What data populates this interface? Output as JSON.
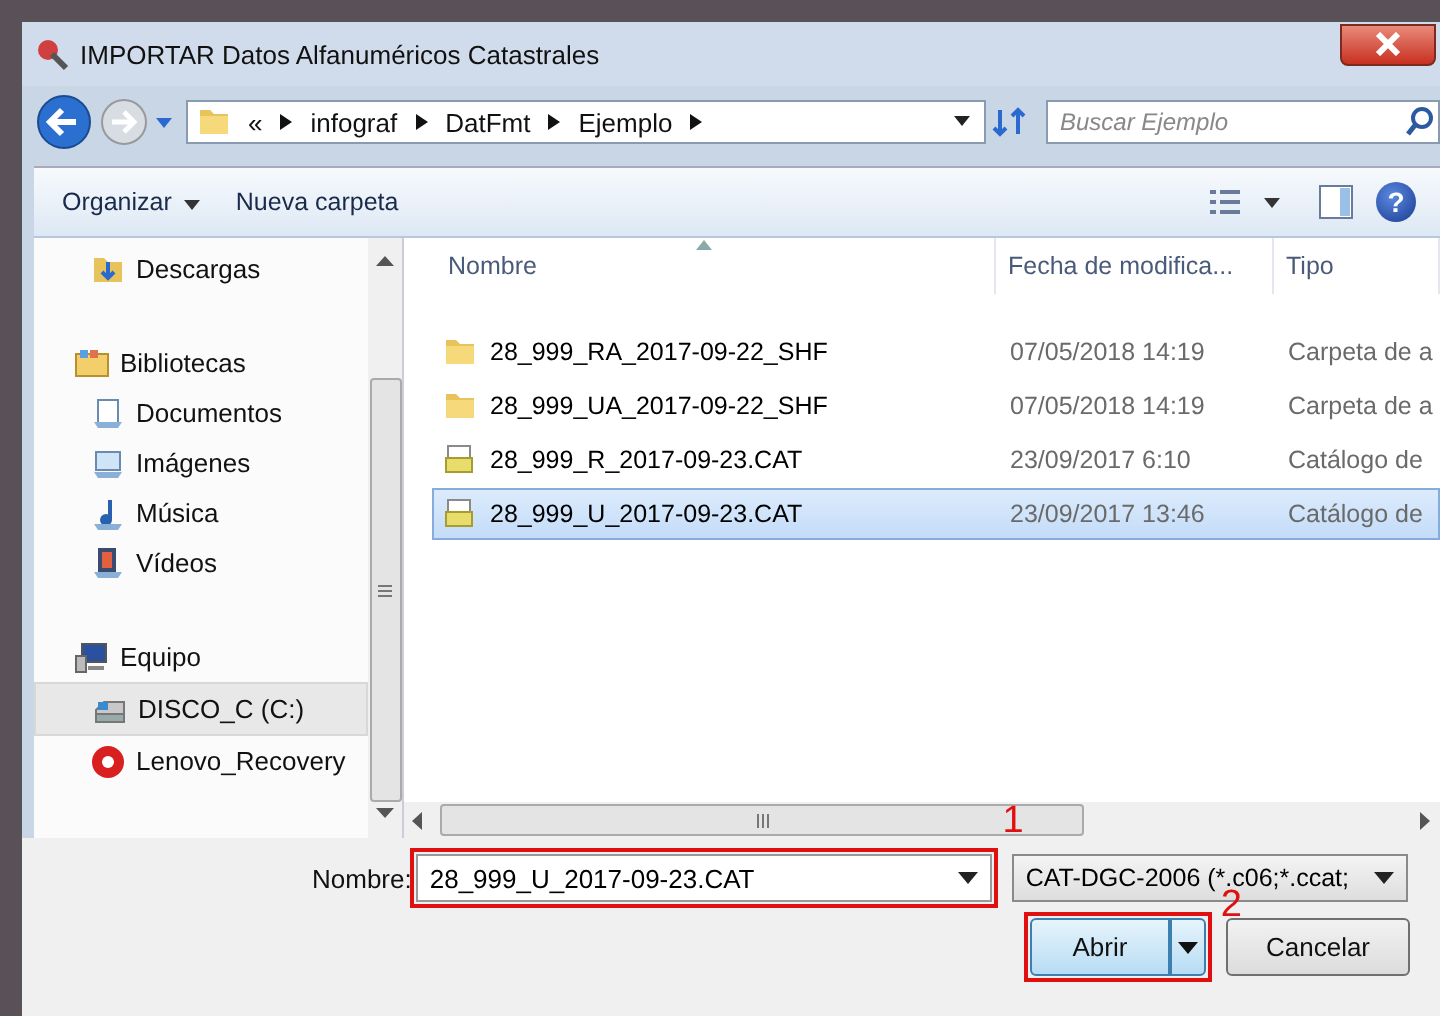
{
  "window": {
    "title": "IMPORTAR Datos Alfanuméricos Catastrales"
  },
  "address": {
    "segments": [
      "«",
      "infograf",
      "DatFmt",
      "Ejemplo"
    ]
  },
  "search": {
    "placeholder": "Buscar Ejemplo"
  },
  "toolbar": {
    "items": [
      {
        "label": "Organizar",
        "dropdown": true
      },
      {
        "label": "Nueva carpeta",
        "dropdown": false
      }
    ],
    "help": "?"
  },
  "nav": {
    "sections": [
      {
        "children": [
          {
            "label": "Descargas",
            "kind": "downloads",
            "selected": false
          }
        ]
      },
      {
        "label": "Bibliotecas",
        "kind": "libraries",
        "children": [
          {
            "label": "Documentos",
            "kind": "documents",
            "selected": false
          },
          {
            "label": "Imágenes",
            "kind": "pictures",
            "selected": false
          },
          {
            "label": "Música",
            "kind": "music",
            "selected": false
          },
          {
            "label": "Vídeos",
            "kind": "videos",
            "selected": false
          }
        ]
      },
      {
        "label": "Equipo",
        "kind": "computer",
        "children": [
          {
            "label": "DISCO_C (C:)",
            "kind": "drive",
            "selected": true
          },
          {
            "label": "Lenovo_Recovery",
            "kind": "recovery",
            "selected": false
          }
        ]
      }
    ]
  },
  "file_list": {
    "columns": [
      {
        "label": "Nombre",
        "sorted": true
      },
      {
        "label": "Fecha de modifica...",
        "sorted": false
      },
      {
        "label": "Tipo",
        "sorted": false
      }
    ],
    "rows": [
      {
        "name": "28_999_RA_2017-09-22_SHF",
        "date": "07/05/2018 14:19",
        "type": "Carpeta de a",
        "kind": "folder",
        "selected": false
      },
      {
        "name": "28_999_UA_2017-09-22_SHF",
        "date": "07/05/2018 14:19",
        "type": "Carpeta de a",
        "kind": "folder",
        "selected": false
      },
      {
        "name": "28_999_R_2017-09-23.CAT",
        "date": "23/09/2017 6:10",
        "type": "Catálogo de",
        "kind": "file",
        "selected": false
      },
      {
        "name": "28_999_U_2017-09-23.CAT",
        "date": "23/09/2017 13:46",
        "type": "Catálogo de",
        "kind": "file",
        "selected": true
      }
    ]
  },
  "footer": {
    "filename": {
      "label": "Nombre:",
      "value": "28_999_U_2017-09-23.CAT",
      "annotation": "1"
    },
    "filter": {
      "value": "CAT-DGC-2006 (*.c06;*.ccat;"
    },
    "buttons": [
      {
        "label": "Abrir",
        "kind": "split",
        "default": true,
        "annotation": "2"
      },
      {
        "label": "Cancelar",
        "kind": "plain",
        "default": false
      }
    ]
  }
}
